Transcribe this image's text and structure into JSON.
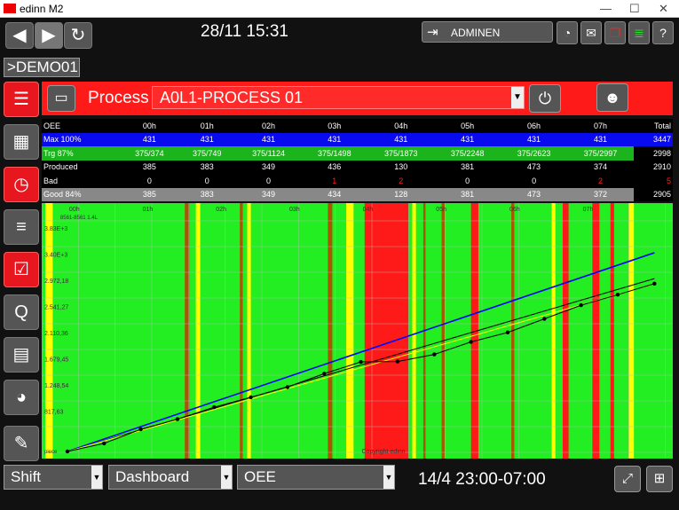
{
  "window": {
    "title": "edinn M2",
    "min": "—",
    "max": "☐",
    "close": "✕"
  },
  "toolbar": {
    "datetime": "28/11 15:31",
    "user": "ADMINEN"
  },
  "breadcrumb": ">DEMO01",
  "process": {
    "label": "Process",
    "selected": "A0L1-PROCESS 01"
  },
  "table": {
    "header": [
      "OEE",
      "00h",
      "01h",
      "02h",
      "03h",
      "04h",
      "05h",
      "06h",
      "07h",
      "Total"
    ],
    "rows": {
      "max": [
        "Max 100%",
        "431",
        "431",
        "431",
        "431",
        "431",
        "431",
        "431",
        "431",
        "3447"
      ],
      "trg": [
        "Trg 87%",
        "375/374",
        "375/749",
        "375/1124",
        "375/1498",
        "375/1873",
        "375/2248",
        "375/2623",
        "375/2997",
        "2998"
      ],
      "prod": [
        "Produced",
        "385",
        "383",
        "349",
        "436",
        "130",
        "381",
        "473",
        "374",
        "2910"
      ],
      "bad": [
        "Bad",
        "0",
        "0",
        "0",
        "1",
        "2",
        "0",
        "0",
        "2",
        "5"
      ],
      "good": [
        "Good 84%",
        "385",
        "383",
        "349",
        "434",
        "128",
        "381",
        "473",
        "372",
        "2905"
      ]
    }
  },
  "chart_data": {
    "type": "line",
    "x_ticks": [
      "23h",
      "00h",
      "01h",
      "02h",
      "03h",
      "04h",
      "05h",
      "06h",
      "07h"
    ],
    "y_ticks": [
      "3.83E+3",
      "3.40E+3",
      "2.972,18",
      "2.541,27",
      "2.110,36",
      "1.679,45",
      "1.248,54",
      "817,63"
    ],
    "ylim": [
      0,
      4000
    ],
    "annotation": "8561-8561 1.4L",
    "watermark": "Copyright edinn",
    "corner_label": "piece",
    "series": [
      {
        "color": "#0000ff",
        "values": [
          [
            0,
            0
          ],
          [
            8,
            3447
          ]
        ]
      },
      {
        "color": "#000000",
        "values": [
          [
            0,
            0
          ],
          [
            8,
            2998
          ]
        ]
      },
      {
        "color": "#ffff00",
        "values": [
          [
            0,
            0
          ],
          [
            8,
            2905
          ]
        ]
      },
      {
        "color": "#000000",
        "markers": true,
        "values": [
          [
            0,
            0
          ],
          [
            0.5,
            140
          ],
          [
            1,
            385
          ],
          [
            1.5,
            560
          ],
          [
            2,
            768
          ],
          [
            2.5,
            940
          ],
          [
            3,
            1117
          ],
          [
            3.5,
            1350
          ],
          [
            4,
            1553
          ],
          [
            4.5,
            1560
          ],
          [
            5,
            1683
          ],
          [
            5.5,
            1900
          ],
          [
            6,
            2064
          ],
          [
            6.5,
            2300
          ],
          [
            7,
            2537
          ],
          [
            7.5,
            2720
          ],
          [
            8,
            2910
          ]
        ]
      }
    ],
    "bands": {
      "red": "#ff1a1a",
      "yellow": "#ffff00",
      "brown": "#aa5500"
    }
  },
  "bottom": {
    "shift": "Shift",
    "view": "Dashboard",
    "metric": "OEE",
    "range": "14/4 23:00-07:00"
  }
}
